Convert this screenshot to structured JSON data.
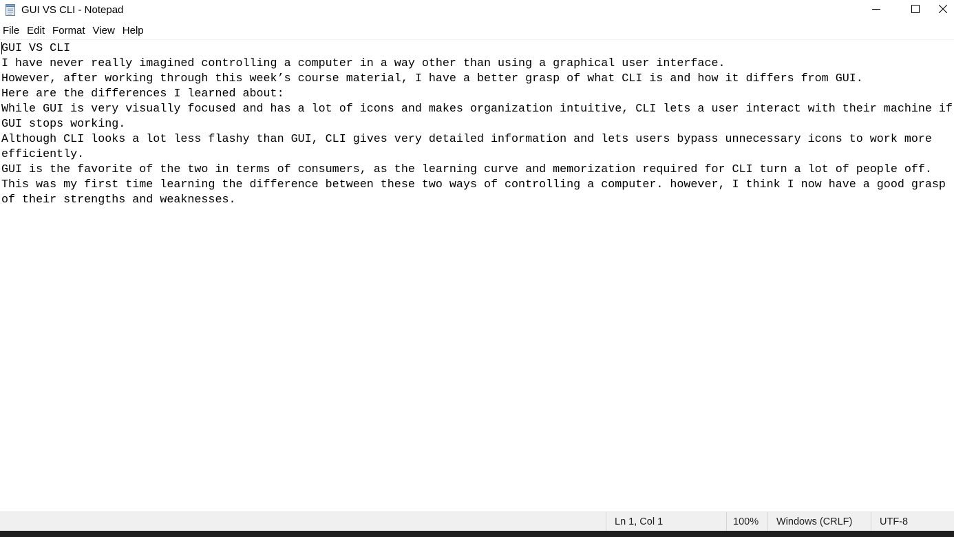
{
  "window": {
    "title": "GUI VS CLI - Notepad",
    "icon": "notepad-icon",
    "controls": {
      "minimize": "minimize-icon",
      "maximize": "maximize-icon",
      "close": "close-icon"
    }
  },
  "menubar": {
    "items": [
      {
        "label": "File"
      },
      {
        "label": "Edit"
      },
      {
        "label": "Format"
      },
      {
        "label": "View"
      },
      {
        "label": "Help"
      }
    ]
  },
  "document": {
    "lines": [
      "GUI VS CLI",
      "I have never really imagined controlling a computer in a way other than using a graphical user interface.",
      "However, after working through this week’s course material, I have a better grasp of what CLI is and how it differs from GUI.",
      "Here are the differences I learned about:",
      "While GUI is very visually focused and has a lot of icons and makes organization intuitive, CLI lets a user interact with their machine if",
      "GUI stops working.",
      "Although CLI looks a lot less flashy than GUI, CLI gives very detailed information and lets users bypass unnecessary icons to work more",
      "efficiently.",
      "GUI is the favorite of the two in terms of consumers, as the learning curve and memorization required for CLI turn a lot of people off.",
      "This was my first time learning the difference between these two ways of controlling a computer. however, I think I now have a good grasp",
      "of their strengths and weaknesses."
    ]
  },
  "statusbar": {
    "position": "Ln 1, Col 1",
    "zoom": "100%",
    "line_ending": "Windows (CRLF)",
    "encoding": "UTF-8"
  },
  "colors": {
    "background": "#ffffff",
    "statusbar_bg": "#f0f0f0",
    "text": "#000000"
  }
}
